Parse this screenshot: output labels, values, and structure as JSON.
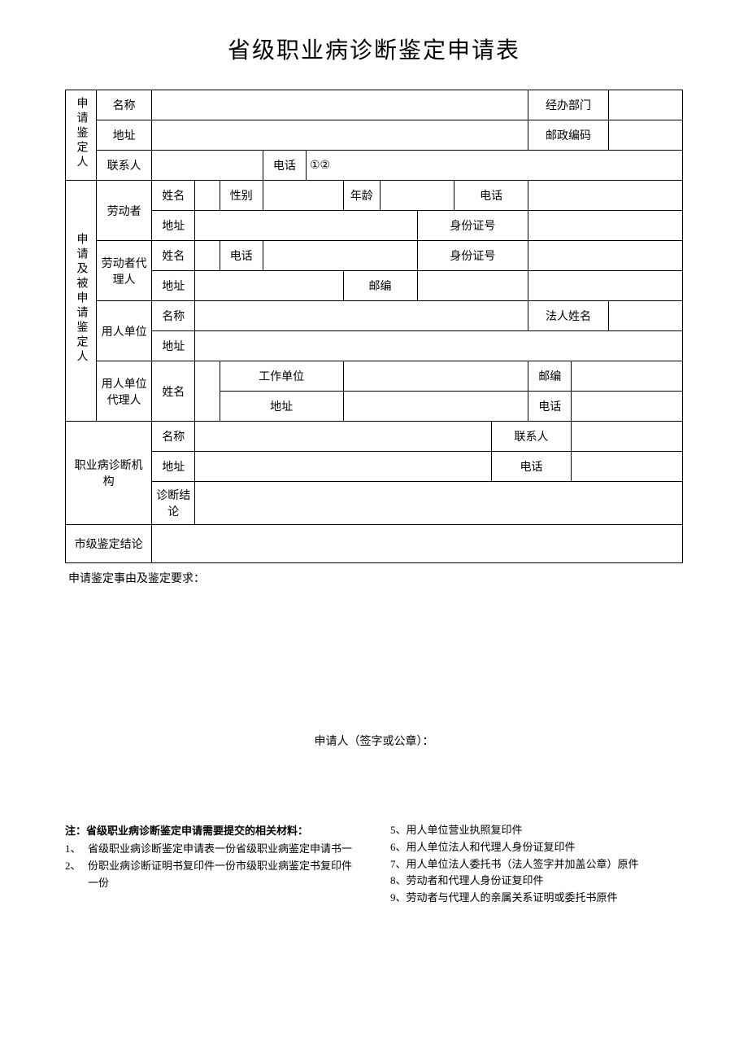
{
  "title": "省级职业病诊断鉴定申请表",
  "section1": {
    "group": "申请鉴定人",
    "row1": {
      "label": "名称",
      "rlabel": "经办部门"
    },
    "row2": {
      "label": "地址",
      "rlabel": "邮政编码"
    },
    "row3": {
      "label": "联系人",
      "midlabel": "电话",
      "val": "①②"
    }
  },
  "section2": {
    "group": "申请及被申请鉴定人",
    "worker": {
      "label": "劳动者",
      "name": "姓名",
      "sex": "性别",
      "age": "年龄",
      "phone": "电话",
      "addr": "地址",
      "id": "身份证号"
    },
    "agent": {
      "label": "劳动者代理人",
      "name": "姓名",
      "phone": "电话",
      "id": "身份证号",
      "addr": "地址",
      "post": "邮编"
    },
    "employer": {
      "label": "用人单位",
      "name": "名称",
      "legal": "法人姓名",
      "addr": "地址"
    },
    "empagent": {
      "label": "用人单位代理人",
      "name": "姓名",
      "unit": "工作单位",
      "post": "邮编",
      "addr": "地址",
      "phone": "电话"
    }
  },
  "section3": {
    "label": "职业病诊断机构",
    "name": "名称",
    "contact": "联系人",
    "addr": "地址",
    "phone": "电话",
    "concl": "诊断结论"
  },
  "section4": {
    "label": "市级鉴定结论"
  },
  "below": "申请鉴定事由及鉴定要求：",
  "signature": "申请人（签字或公章）：",
  "notes": {
    "title": "注：省级职业病诊断鉴定申请需要提交的相关材料：",
    "leftNums": "1、2、",
    "leftTxt": "省级职业病诊断鉴定申请表一份省级职业病鉴定申请书一份职业病诊断证明书复印件一份市级职业病鉴定书复印件一份",
    "right": [
      "5、用人单位营业执照复印件",
      "6、用人单位法人和代理人身份证复印件",
      "7、用人单位法人委托书（法人签字并加盖公章）原件",
      "8、劳动者和代理人身份证复印件",
      "9、劳动者与代理人的亲属关系证明或委托书原件"
    ]
  }
}
